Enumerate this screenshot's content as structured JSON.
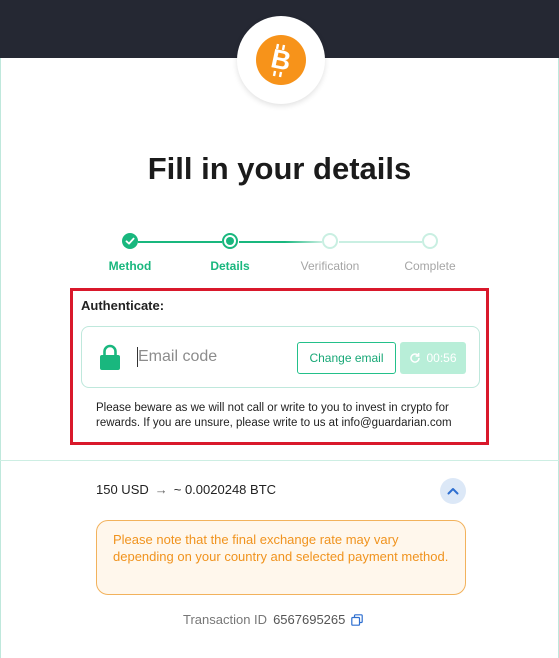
{
  "page": {
    "title": "Fill in your details"
  },
  "logo": {
    "icon": "bitcoin-icon",
    "color": "#f7931a"
  },
  "stepper": {
    "steps": [
      {
        "label": "Method",
        "state": "done"
      },
      {
        "label": "Details",
        "state": "current"
      },
      {
        "label": "Verification",
        "state": "pending"
      },
      {
        "label": "Complete",
        "state": "pending"
      }
    ],
    "active_color": "#19b77e",
    "pending_color": "#c9efe2"
  },
  "auth": {
    "label": "Authenticate:",
    "email_code_placeholder": "Email code",
    "email_code_value": "",
    "change_email_label": "Change email",
    "timer_label": "00:56",
    "warning": "Please beware as we will not call or write to you to invest in crypto for rewards. If you are unsure, please write to us at info@guardarian.com"
  },
  "exchange": {
    "from": "150 USD",
    "arrow": "→",
    "to": "~ 0.0020248 BTC",
    "notice": "Please note that the final exchange rate may vary depending on your country and selected payment method."
  },
  "transaction": {
    "label": "Transaction ID",
    "value": "6567695265"
  },
  "colors": {
    "topbar": "#252833",
    "accent": "#19b77e",
    "highlight_border": "#d9182b",
    "notice_text": "#f0931e"
  }
}
